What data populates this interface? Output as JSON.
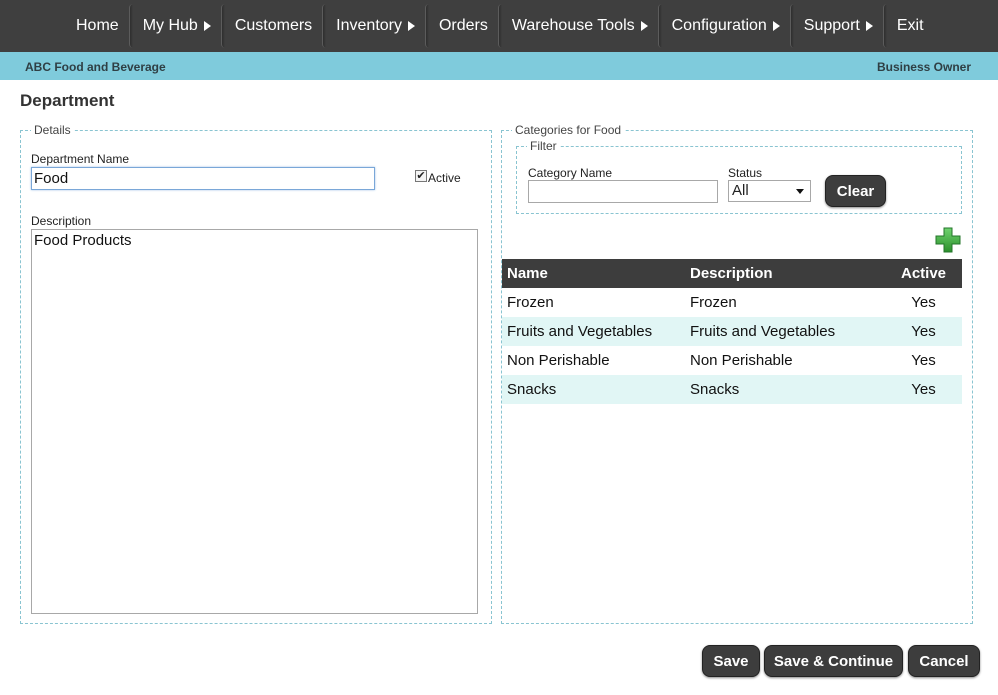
{
  "nav": {
    "items": [
      {
        "label": "Home",
        "has_arrow": false
      },
      {
        "label": "My Hub",
        "has_arrow": true
      },
      {
        "label": "Customers",
        "has_arrow": false
      },
      {
        "label": "Inventory",
        "has_arrow": true
      },
      {
        "label": "Orders",
        "has_arrow": false
      },
      {
        "label": "Warehouse Tools",
        "has_arrow": true
      },
      {
        "label": "Configuration",
        "has_arrow": true
      },
      {
        "label": "Support",
        "has_arrow": true
      },
      {
        "label": "Exit",
        "has_arrow": false
      }
    ]
  },
  "subbar": {
    "company": "ABC Food and Beverage",
    "role": "Business Owner"
  },
  "page": {
    "title": "Department"
  },
  "details": {
    "legend": "Details",
    "name_label": "Department Name",
    "name_value": "Food",
    "active_label": "Active",
    "active_checked": true,
    "description_label": "Description",
    "description_value": "Food Products"
  },
  "categories": {
    "legend": "Categories for Food",
    "filter": {
      "legend": "Filter",
      "category_name_label": "Category Name",
      "category_name_value": "",
      "status_label": "Status",
      "status_value": "All",
      "clear_label": "Clear"
    },
    "table": {
      "headers": {
        "name": "Name",
        "description": "Description",
        "active": "Active"
      },
      "rows": [
        {
          "name": "Frozen",
          "description": "Frozen",
          "active": "Yes"
        },
        {
          "name": "Fruits and Vegetables",
          "description": "Fruits and Vegetables",
          "active": "Yes"
        },
        {
          "name": "Non Perishable",
          "description": "Non Perishable",
          "active": "Yes"
        },
        {
          "name": "Snacks",
          "description": "Snacks",
          "active": "Yes"
        }
      ]
    }
  },
  "actions": {
    "save": "Save",
    "save_continue": "Save & Continue",
    "cancel": "Cancel"
  },
  "colors": {
    "nav_bg": "#3f3f3f",
    "subbar_bg": "#7fcbdc",
    "alt_row": "#e1f6f5",
    "add_icon": "#3aa53a"
  }
}
